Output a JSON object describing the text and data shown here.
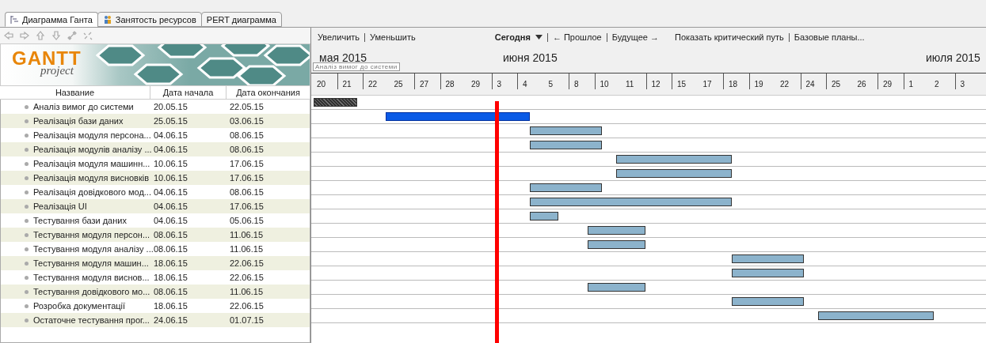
{
  "tabs": [
    {
      "label": "Диаграмма Ганта",
      "selected": true
    },
    {
      "label": "Занятость ресурсов",
      "selected": false
    },
    {
      "label": "PERT диаграмма",
      "selected": false
    }
  ],
  "logo": {
    "text": "GANTT",
    "subtitle": "project"
  },
  "table": {
    "columns": [
      "Название",
      "Дата начала",
      "Дата окончания"
    ],
    "rows": [
      {
        "name": "Аналіз вимог до системи",
        "start": "20.05.15",
        "end": "22.05.15",
        "selected": false,
        "completed": true
      },
      {
        "name": "Реалізація бази даних",
        "start": "25.05.15",
        "end": "03.06.15",
        "selected": true,
        "completed": false
      },
      {
        "name": "Реалізація модуля персона...",
        "start": "04.06.15",
        "end": "08.06.15",
        "selected": false,
        "completed": false
      },
      {
        "name": "Реалізація модулів аналізу ...",
        "start": "04.06.15",
        "end": "08.06.15",
        "selected": false,
        "completed": false
      },
      {
        "name": "Реалізація модуля машинн...",
        "start": "10.06.15",
        "end": "17.06.15",
        "selected": false,
        "completed": false
      },
      {
        "name": "Реалізація модуля висновків",
        "start": "10.06.15",
        "end": "17.06.15",
        "selected": false,
        "completed": false
      },
      {
        "name": "Реалізація довідкового мод...",
        "start": "04.06.15",
        "end": "08.06.15",
        "selected": false,
        "completed": false
      },
      {
        "name": "Реалізація UI",
        "start": "04.06.15",
        "end": "17.06.15",
        "selected": false,
        "completed": false
      },
      {
        "name": "Тестування бази даних",
        "start": "04.06.15",
        "end": "05.06.15",
        "selected": false,
        "completed": false
      },
      {
        "name": "Тестування модуля персон...",
        "start": "08.06.15",
        "end": "11.06.15",
        "selected": false,
        "completed": false
      },
      {
        "name": "Тестування модуля аналізу ...",
        "start": "08.06.15",
        "end": "11.06.15",
        "selected": false,
        "completed": false
      },
      {
        "name": "Тестування модуля машин...",
        "start": "18.06.15",
        "end": "22.06.15",
        "selected": false,
        "completed": false
      },
      {
        "name": "Тестування модуля виснов...",
        "start": "18.06.15",
        "end": "22.06.15",
        "selected": false,
        "completed": false
      },
      {
        "name": "Тестування довідкового мо...",
        "start": "08.06.15",
        "end": "11.06.15",
        "selected": false,
        "completed": false
      },
      {
        "name": "Розробка документації",
        "start": "18.06.15",
        "end": "22.06.15",
        "selected": false,
        "completed": false
      },
      {
        "name": "Остаточне тестування прог...",
        "start": "24.06.15",
        "end": "01.07.15",
        "selected": false,
        "completed": false
      }
    ]
  },
  "gantt_toolbar": {
    "left": [
      "Увеличить",
      "Уменьшить"
    ],
    "today": "Сегодня",
    "nav": [
      "← Прошлое",
      "Будущее →"
    ],
    "right": [
      "Показать критический путь",
      "Базовые планы..."
    ]
  },
  "timeline": {
    "months": [
      "мая 2015",
      "июня 2015",
      "июля 2015"
    ],
    "days": [
      "20",
      "21",
      "22",
      "25",
      "27",
      "28",
      "29",
      "3",
      "4",
      "5",
      "8",
      "10",
      "11",
      "12",
      "15",
      "17",
      "18",
      "19",
      "22",
      "24",
      "25",
      "26",
      "29",
      "1",
      "2",
      "3"
    ],
    "tooltip": "Аналіз вимог до системи"
  }
}
